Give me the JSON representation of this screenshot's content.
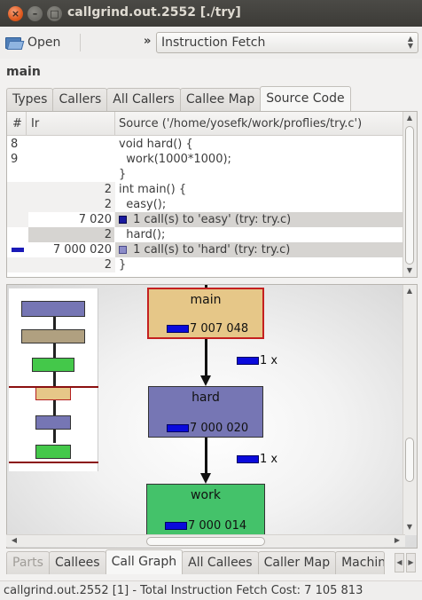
{
  "window": {
    "title": "callgrind.out.2552 [./try]",
    "buttons": {
      "close": "×",
      "minimize": "–",
      "maximize": "□"
    }
  },
  "toolbar": {
    "open_label": "Open",
    "overflow_chevron": "»",
    "event_type": "Instruction Fetch"
  },
  "function_name": "main",
  "top_tabs": [
    "Types",
    "Callers",
    "All Callers",
    "Callee Map",
    "Source Code"
  ],
  "top_active_tab": "Source Code",
  "source": {
    "headers": {
      "num": "#",
      "ir": "Ir",
      "source": "Source ('/home/yosefk/work/proflies/try.c')"
    },
    "rows": [
      {
        "line": "8",
        "ir": "",
        "text": "void hard() {"
      },
      {
        "line": "9",
        "ir": "",
        "text": "  work(1000*1000);"
      },
      {
        "line": "",
        "ir": "",
        "text": "}"
      },
      {
        "line": "",
        "ir": "2",
        "text": "int main() {"
      },
      {
        "line": "",
        "ir": "2",
        "text": "  easy();"
      },
      {
        "line": "",
        "ir": "7 020",
        "text": "1 call(s) to 'easy' (try: try.c)"
      },
      {
        "line": "",
        "ir": "2",
        "text": "  hard();"
      },
      {
        "line": "",
        "ir": "7 000 020",
        "text": "1 call(s) to 'hard' (try: try.c)"
      },
      {
        "line": "",
        "ir": "2",
        "text": "}"
      }
    ]
  },
  "call_graph": {
    "nodes": [
      {
        "name": "main",
        "cost": "7 007 048",
        "color": "#e6c788"
      },
      {
        "name": "hard",
        "cost": "7 000 020",
        "color": "#7676b4"
      },
      {
        "name": "work",
        "cost": "7 000 014",
        "color": "#44c26a"
      }
    ],
    "edges": [
      {
        "from": "main",
        "to": "hard",
        "label": "1 x"
      },
      {
        "from": "hard",
        "to": "work",
        "label": "1 x"
      }
    ],
    "overview_colors": [
      "#7676b4",
      "#b0a080",
      "#44c84a",
      "#e6c788",
      "#7676b4",
      "#44c84a"
    ]
  },
  "bottom_tabs": [
    "Parts",
    "Callees",
    "Call Graph",
    "All Callees",
    "Caller Map",
    "Machine"
  ],
  "bottom_active_tab": "Call Graph",
  "status": "callgrind.out.2552 [1] - Total Instruction Fetch Cost: 7 105 813"
}
